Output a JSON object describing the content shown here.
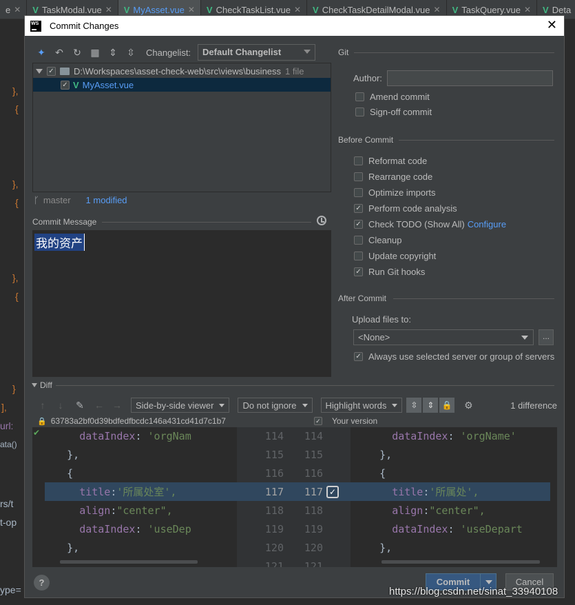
{
  "editor_tabs": [
    {
      "label": "e",
      "active": false
    },
    {
      "label": "TaskModal.vue",
      "active": false
    },
    {
      "label": "MyAsset.vue",
      "active": true
    },
    {
      "label": "CheckTaskList.vue",
      "active": false
    },
    {
      "label": "CheckTaskDetailModal.vue",
      "active": false
    },
    {
      "label": "TaskQuery.vue",
      "active": false
    },
    {
      "label": "Deta",
      "active": false
    }
  ],
  "background_code": {
    "lines": [
      "},",
      "{",
      "},",
      "{",
      "},",
      "{",
      "}",
      "],",
      "url:",
      "ata()",
      "rs/t",
      "t-op",
      "ype="
    ]
  },
  "dialog": {
    "title": "Commit Changes",
    "changelist_label": "Changelist:",
    "changelist_value": "Default Changelist",
    "tree": {
      "folder_path": "D:\\Workspaces\\asset-check-web\\src\\views\\business",
      "folder_count": "1 file",
      "file_name": "MyAsset.vue"
    },
    "branch": "master",
    "modified": "1 modified",
    "commit_message_label": "Commit Message",
    "commit_message": "我的资产",
    "git": {
      "section": "Git",
      "author_label": "Author:",
      "author_value": "",
      "amend": "Amend commit",
      "signoff": "Sign-off commit"
    },
    "before_commit": {
      "section": "Before Commit",
      "options": [
        {
          "label": "Reformat code",
          "checked": false
        },
        {
          "label": "Rearrange code",
          "checked": false
        },
        {
          "label": "Optimize imports",
          "checked": false
        },
        {
          "label": "Perform code analysis",
          "checked": true
        },
        {
          "label": "Check TODO (Show All)",
          "checked": true,
          "link": "Configure"
        },
        {
          "label": "Cleanup",
          "checked": false
        },
        {
          "label": "Update copyright",
          "checked": false
        },
        {
          "label": "Run Git hooks",
          "checked": true
        }
      ]
    },
    "after_commit": {
      "section": "After Commit",
      "upload_label": "Upload files to:",
      "upload_value": "<None>",
      "dots": "...",
      "always_use": "Always use selected server or group of servers"
    },
    "diff": {
      "section": "Diff",
      "viewer": "Side-by-side viewer",
      "ignore": "Do not ignore",
      "highlight": "Highlight words",
      "difference_count": "1 difference",
      "left_hash": "63783a2bf0d39bdfedfbcdc146a431cd41d7c1b7",
      "right_label": "Your version",
      "left_lines": [
        {
          "indent": "      ",
          "key": "dataIndex",
          "val": "'orgNam"
        },
        {
          "indent": "    ",
          "brace": "},"
        },
        {
          "indent": "    ",
          "brace": "{"
        },
        {
          "indent": "      ",
          "key": "title",
          "val": "'所属处室',"
        },
        {
          "indent": "      ",
          "key": "align",
          "val": "\"center\","
        },
        {
          "indent": "      ",
          "key": "dataIndex",
          "val": "'useDep"
        },
        {
          "indent": "    ",
          "brace": "},"
        }
      ],
      "right_lines": [
        {
          "indent": "      ",
          "key": "dataIndex",
          "val": "'orgName'"
        },
        {
          "indent": "    ",
          "brace": "},"
        },
        {
          "indent": "    ",
          "brace": "{"
        },
        {
          "indent": "      ",
          "key": "title",
          "val": "'所属处',"
        },
        {
          "indent": "      ",
          "key": "align",
          "val": "\"center\","
        },
        {
          "indent": "      ",
          "key": "dataIndex",
          "val": "'useDepart"
        },
        {
          "indent": "    ",
          "brace": "},"
        }
      ],
      "line_numbers": [
        "114",
        "115",
        "116",
        "117",
        "118",
        "119",
        "120",
        "121"
      ]
    },
    "buttons": {
      "help": "?",
      "commit": "Commit",
      "cancel": "Cancel"
    }
  },
  "watermark": "https://blog.csdn.net/sinat_33940108"
}
